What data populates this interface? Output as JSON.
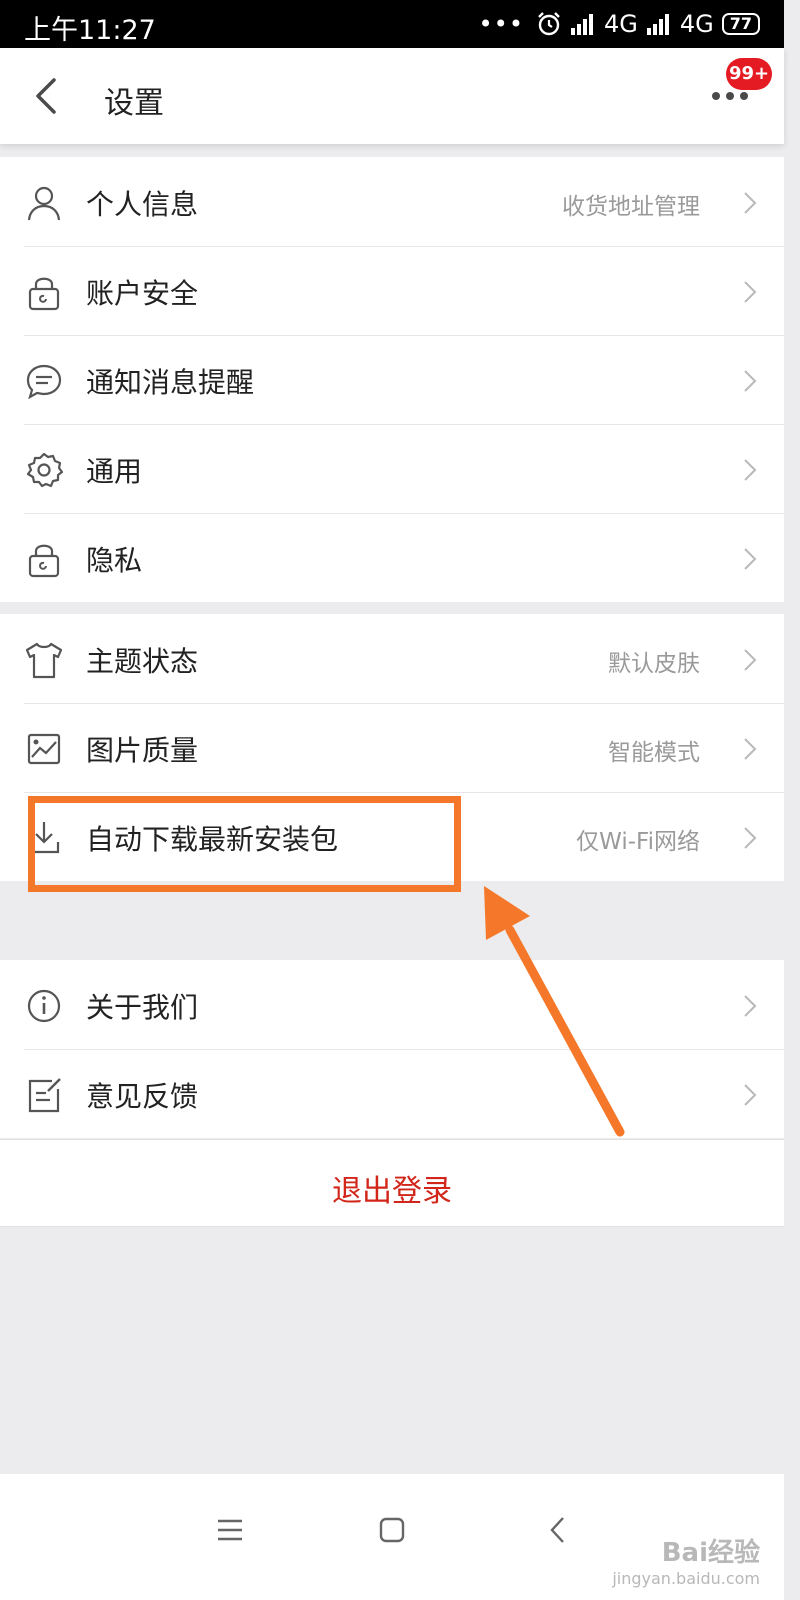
{
  "status_bar": {
    "time": "上午11:27",
    "dots": "•••",
    "network_1": "4G",
    "network_2": "4G",
    "battery": "77"
  },
  "header": {
    "title": "设置",
    "badge": "99+"
  },
  "groups": [
    {
      "items": [
        {
          "label": "个人信息",
          "value": "收货地址管理",
          "icon": "user-icon"
        },
        {
          "label": "账户安全",
          "value": "",
          "icon": "lock-icon"
        },
        {
          "label": "通知消息提醒",
          "value": "",
          "icon": "chat-bubble-icon"
        },
        {
          "label": "通用",
          "value": "",
          "icon": "gear-icon"
        },
        {
          "label": "隐私",
          "value": "",
          "icon": "lock-icon"
        }
      ]
    },
    {
      "items": [
        {
          "label": "主题状态",
          "value": "默认皮肤",
          "icon": "tshirt-icon"
        },
        {
          "label": "图片质量",
          "value": "智能模式",
          "icon": "image-icon"
        },
        {
          "label": "自动下载最新安装包",
          "value": "仅Wi-Fi网络",
          "icon": "download-icon"
        }
      ]
    },
    {
      "items": [
        {
          "label": "关于我们",
          "value": "",
          "icon": "info-icon"
        },
        {
          "label": "意见反馈",
          "value": "",
          "icon": "feedback-icon"
        }
      ]
    }
  ],
  "logout": {
    "label": "退出登录"
  },
  "watermark": {
    "main": "Bai经验",
    "sub": "jingyan.baidu.com"
  },
  "colors": {
    "accent_red": "#d2261b",
    "badge_red": "#e51b23",
    "highlight_orange": "#f5782a",
    "background": "#ececee"
  }
}
